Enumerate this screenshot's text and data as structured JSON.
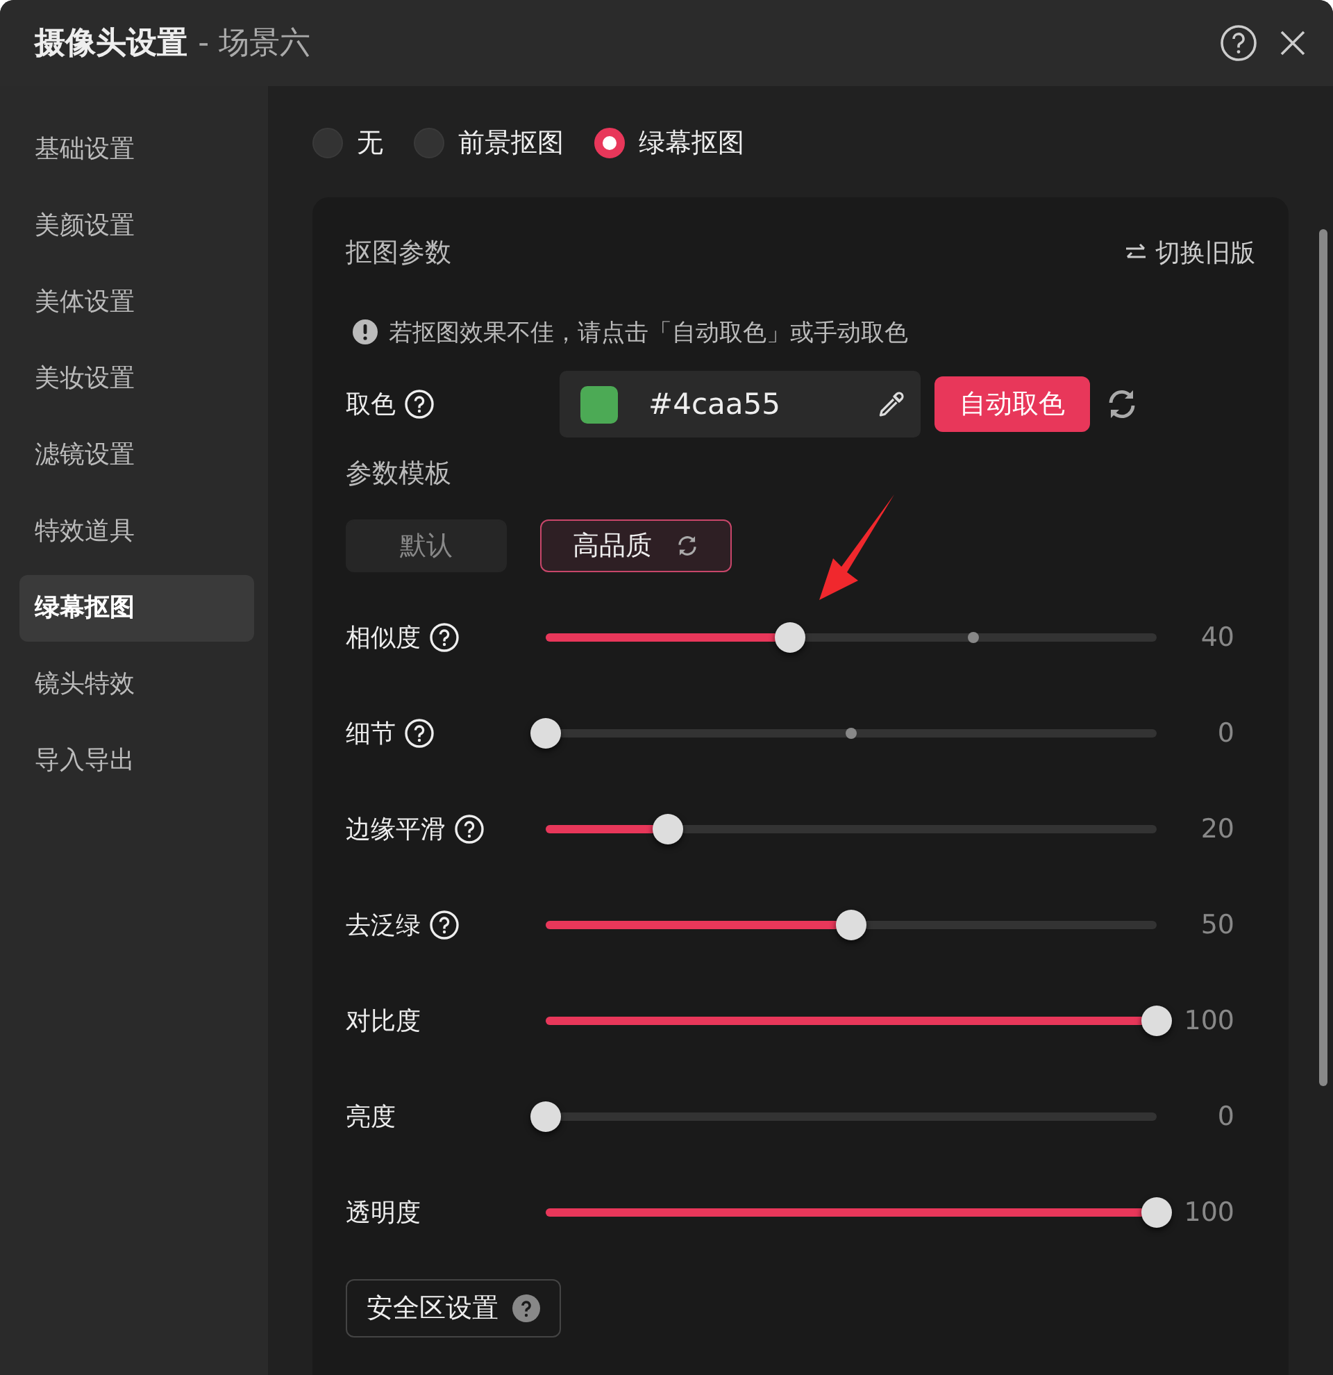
{
  "window": {
    "title": "摄像头设置",
    "subtitle": "- 场景六"
  },
  "sidebar": {
    "items": [
      {
        "label": "基础设置",
        "selected": false
      },
      {
        "label": "美颜设置",
        "selected": false
      },
      {
        "label": "美体设置",
        "selected": false
      },
      {
        "label": "美妆设置",
        "selected": false
      },
      {
        "label": "滤镜设置",
        "selected": false
      },
      {
        "label": "特效道具",
        "selected": false
      },
      {
        "label": "绿幕抠图",
        "selected": true
      },
      {
        "label": "镜头特效",
        "selected": false
      },
      {
        "label": "导入导出",
        "selected": false
      }
    ]
  },
  "mode_options": [
    {
      "label": "无",
      "selected": false
    },
    {
      "label": "前景抠图",
      "selected": false
    },
    {
      "label": "绿幕抠图",
      "selected": true
    }
  ],
  "panel": {
    "title": "抠图参数",
    "switch_link": "切换旧版",
    "notice": "若抠图效果不佳，请点击「自动取色」或手动取色",
    "color_pick": {
      "label": "取色",
      "color": "#4caa55",
      "value": "#4caa55",
      "auto_button": "自动取色"
    },
    "template_label": "参数模板",
    "templates": [
      {
        "label": "默认",
        "selected": false
      },
      {
        "label": "高品质",
        "selected": true
      }
    ],
    "sliders": [
      {
        "label": "相似度",
        "help": true,
        "level": 0.4,
        "reading": "40",
        "marker": {
          "level": 0.7
        }
      },
      {
        "label": "细节",
        "help": true,
        "level": 0,
        "reading": "0",
        "marker": {
          "level": 0.5
        }
      },
      {
        "label": "边缘平滑",
        "help": true,
        "level": 0.2,
        "reading": "20"
      },
      {
        "label": "去泛绿",
        "help": true,
        "level": 0.5,
        "reading": "50"
      },
      {
        "label": "对比度",
        "help": false,
        "level": 1,
        "reading": "100"
      },
      {
        "label": "亮度",
        "help": false,
        "level": 0,
        "reading": "0"
      },
      {
        "label": "透明度",
        "help": false,
        "level": 1,
        "reading": "100"
      }
    ],
    "safe_zone_button": "安全区设置"
  }
}
